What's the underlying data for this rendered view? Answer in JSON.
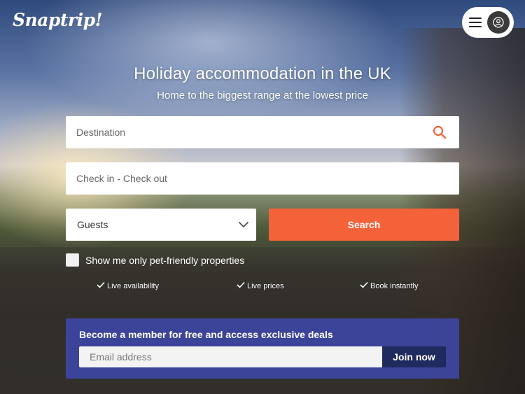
{
  "header": {
    "logo_text": "Snaptrip!",
    "menu_icon": "hamburger-icon",
    "account_icon": "user-icon"
  },
  "hero": {
    "title": "Holiday accommodation in the UK",
    "subtitle": "Home to the biggest range at the lowest price"
  },
  "search": {
    "destination_placeholder": "Destination",
    "dates_placeholder": "Check in - Check out",
    "guests_label": "Guests",
    "search_label": "Search",
    "pet_label": "Show me only pet-friendly properties"
  },
  "features": [
    {
      "label": "Live availability"
    },
    {
      "label": "Live prices"
    },
    {
      "label": "Book instantly"
    }
  ],
  "membership": {
    "title": "Become a member for free and access exclusive deals",
    "email_placeholder": "Email address",
    "join_label": "Join now"
  },
  "colors": {
    "accent": "#f4623a",
    "member_bg": "#3c46a0",
    "join_bg": "#1f2a5e"
  }
}
